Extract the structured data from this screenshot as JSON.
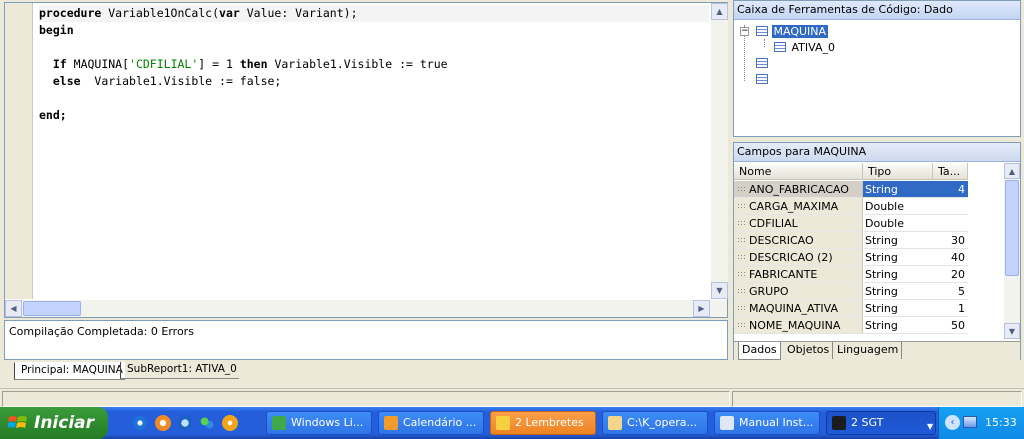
{
  "editor": {
    "lines": [
      {
        "parts": [
          {
            "t": "procedure",
            "c": "kw"
          },
          {
            "t": " Variable1OnCalc(",
            "c": ""
          },
          {
            "t": "var",
            "c": "kw"
          },
          {
            "t": " Value: Variant);",
            "c": ""
          }
        ]
      },
      {
        "parts": [
          {
            "t": "begin",
            "c": "kw"
          }
        ]
      },
      {
        "parts": []
      },
      {
        "parts": [
          {
            "t": "  ",
            "c": ""
          },
          {
            "t": "If",
            "c": "kw"
          },
          {
            "t": " MAQUINA[",
            "c": ""
          },
          {
            "t": "'CDFILIAL'",
            "c": "str"
          },
          {
            "t": "] = 1 ",
            "c": ""
          },
          {
            "t": "then",
            "c": "kw"
          },
          {
            "t": " Variable1.Visible := true",
            "c": ""
          }
        ]
      },
      {
        "parts": [
          {
            "t": "  ",
            "c": ""
          },
          {
            "t": "else",
            "c": "kw"
          },
          {
            "t": "  Variable1.Visible := false;",
            "c": ""
          }
        ]
      },
      {
        "parts": []
      },
      {
        "parts": [
          {
            "t": "end;",
            "c": "kw"
          }
        ]
      }
    ]
  },
  "messages": {
    "text": "Compilação Completada: 0 Errors"
  },
  "report_tabs": [
    "Principal: MAQUINA",
    "SubReport1: ATIVA_0"
  ],
  "toolbox": {
    "title": "Caixa de Ferramentas de Código: Dado",
    "tree": {
      "root": "MAQUINA",
      "child": "ATIVA_0"
    }
  },
  "fields": {
    "title": "Campos para MAQUINA",
    "columns": [
      "Nome",
      "Tipo",
      "Ta..."
    ],
    "rows": [
      {
        "name": "ANO_FABRICACAO",
        "type": "String",
        "size": "4"
      },
      {
        "name": "CARGA_MAXIMA",
        "type": "Double",
        "size": ""
      },
      {
        "name": "CDFILIAL",
        "type": "Double",
        "size": ""
      },
      {
        "name": "DESCRICAO",
        "type": "String",
        "size": "30"
      },
      {
        "name": "DESCRICAO (2)",
        "type": "String",
        "size": "40"
      },
      {
        "name": "FABRICANTE",
        "type": "String",
        "size": "20"
      },
      {
        "name": "GRUPO",
        "type": "String",
        "size": "5"
      },
      {
        "name": "MAQUINA_ATIVA",
        "type": "String",
        "size": "1"
      },
      {
        "name": "NOME_MAQUINA",
        "type": "String",
        "size": "50"
      }
    ],
    "tabs": [
      "Dados",
      "Objetos",
      "Linguagem"
    ]
  },
  "taskbar": {
    "start_label": "Iniciar",
    "buttons": [
      {
        "label": "Windows Li...",
        "icon_color": "#3fa84a"
      },
      {
        "label": "Calendário ...",
        "icon_color": "#f39c2b"
      },
      {
        "label": "2 Lembretes",
        "icon_color": "#f5d142"
      },
      {
        "label": "C:\\K_opera...",
        "icon_color": "#f3d58c"
      },
      {
        "label": "Manual Inst...",
        "icon_color": "#dfe6f5"
      },
      {
        "label": "2 SGT",
        "icon_color": "#1c1c1c"
      }
    ],
    "clock": "15:33"
  }
}
